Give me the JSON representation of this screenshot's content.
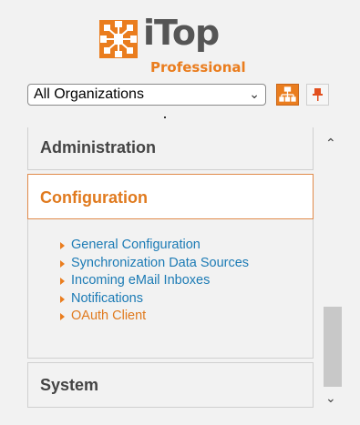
{
  "logo": {
    "brand": "iTop",
    "edition": "Professional",
    "accent_color": "#ea7d1e"
  },
  "org_selector": {
    "value": "All Organizations",
    "icon": "chevron-down-icon"
  },
  "toolbar": {
    "org_button_icon": "org-chart-icon",
    "pin_button_icon": "pin-icon"
  },
  "menu": {
    "groups": [
      {
        "label": "Administration"
      },
      {
        "label": "Configuration",
        "active": true
      },
      {
        "label": "System"
      }
    ],
    "configuration_items": [
      {
        "label": "General Configuration"
      },
      {
        "label": "Synchronization Data Sources"
      },
      {
        "label": "Incoming eMail Inboxes"
      },
      {
        "label": "Notifications"
      },
      {
        "label": "OAuth Client",
        "highlighted": true
      }
    ]
  },
  "colors": {
    "link": "#1c7bb5",
    "active_header": "#e07a1e",
    "highlight": "#ffff33"
  }
}
